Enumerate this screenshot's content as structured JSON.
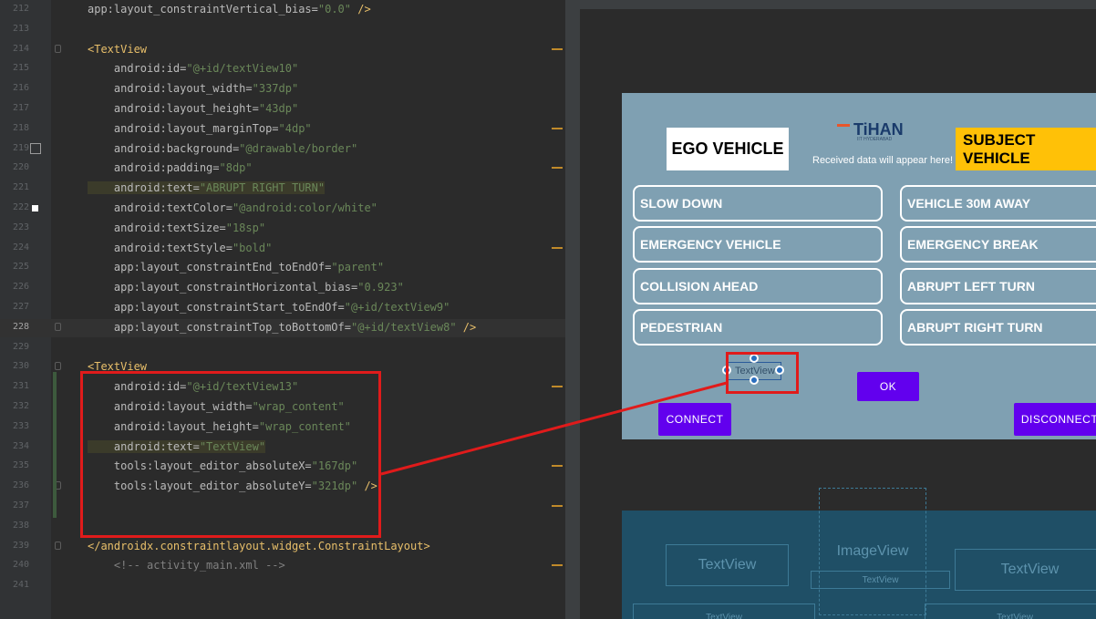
{
  "editor": {
    "lines": [
      {
        "no": "212",
        "tokens": [
          {
            "c": "t-attr",
            "t": "app:layout_constraintVertical_bias="
          },
          {
            "c": "t-val",
            "t": "\"0.0\""
          },
          {
            "c": "t-tag",
            "t": " />"
          }
        ]
      },
      {
        "no": "213",
        "tokens": []
      },
      {
        "no": "214",
        "tokens": [
          {
            "c": "t-tag",
            "t": "<TextView"
          }
        ]
      },
      {
        "no": "215",
        "tokens": [
          {
            "c": "t-attr",
            "t": "    android:id="
          },
          {
            "c": "t-val",
            "t": "\"@+id/textView10\""
          }
        ]
      },
      {
        "no": "216",
        "tokens": [
          {
            "c": "t-attr",
            "t": "    android:layout_width="
          },
          {
            "c": "t-val",
            "t": "\"337dp\""
          }
        ]
      },
      {
        "no": "217",
        "tokens": [
          {
            "c": "t-attr",
            "t": "    android:layout_height="
          },
          {
            "c": "t-val",
            "t": "\"43dp\""
          }
        ]
      },
      {
        "no": "218",
        "tokens": [
          {
            "c": "t-attr",
            "t": "    android:layout_marginTop="
          },
          {
            "c": "t-val",
            "t": "\"4dp\""
          }
        ]
      },
      {
        "no": "219",
        "tokens": [
          {
            "c": "t-attr",
            "t": "    android:background="
          },
          {
            "c": "t-val",
            "t": "\"@drawable/border\""
          }
        ]
      },
      {
        "no": "220",
        "tokens": [
          {
            "c": "t-attr",
            "t": "    android:padding="
          },
          {
            "c": "t-val",
            "t": "\"8dp\""
          }
        ]
      },
      {
        "no": "221",
        "tokens": [
          {
            "c": "t-attr hl",
            "t": "    android:text="
          },
          {
            "c": "t-val hl",
            "t": "\"ABRUPT RIGHT TURN\""
          }
        ]
      },
      {
        "no": "222",
        "tokens": [
          {
            "c": "t-attr",
            "t": "    android:textColor="
          },
          {
            "c": "t-val",
            "t": "\"@android:color/white\""
          }
        ]
      },
      {
        "no": "223",
        "tokens": [
          {
            "c": "t-attr",
            "t": "    android:textSize="
          },
          {
            "c": "t-val",
            "t": "\"18sp\""
          }
        ]
      },
      {
        "no": "224",
        "tokens": [
          {
            "c": "t-attr",
            "t": "    android:textStyle="
          },
          {
            "c": "t-val",
            "t": "\"bold\""
          }
        ]
      },
      {
        "no": "225",
        "tokens": [
          {
            "c": "t-attr",
            "t": "    app:layout_constraintEnd_toEndOf="
          },
          {
            "c": "t-val",
            "t": "\"parent\""
          }
        ]
      },
      {
        "no": "226",
        "tokens": [
          {
            "c": "t-attr",
            "t": "    app:layout_constraintHorizontal_bias="
          },
          {
            "c": "t-val",
            "t": "\"0.923\""
          }
        ]
      },
      {
        "no": "227",
        "tokens": [
          {
            "c": "t-attr",
            "t": "    app:layout_constraintStart_toEndOf="
          },
          {
            "c": "t-val",
            "t": "\"@+id/textView9\""
          }
        ]
      },
      {
        "no": "228",
        "tokens": [
          {
            "c": "t-attr",
            "t": "    app:layout_constraintTop_toBottomOf="
          },
          {
            "c": "t-val",
            "t": "\"@+id/textView8\""
          },
          {
            "c": "t-tag",
            "t": " />"
          }
        ]
      },
      {
        "no": "229",
        "tokens": []
      },
      {
        "no": "230",
        "tokens": [
          {
            "c": "t-tag",
            "t": "<TextView"
          }
        ]
      },
      {
        "no": "231",
        "tokens": [
          {
            "c": "t-attr",
            "t": "    android:id="
          },
          {
            "c": "t-val",
            "t": "\"@+id/textView13\""
          }
        ]
      },
      {
        "no": "232",
        "tokens": [
          {
            "c": "t-attr",
            "t": "    android:layout_width="
          },
          {
            "c": "t-val",
            "t": "\"wrap_content\""
          }
        ]
      },
      {
        "no": "233",
        "tokens": [
          {
            "c": "t-attr",
            "t": "    android:layout_height="
          },
          {
            "c": "t-val",
            "t": "\"wrap_content\""
          }
        ]
      },
      {
        "no": "234",
        "tokens": [
          {
            "c": "t-attr hl",
            "t": "    android:text="
          },
          {
            "c": "t-val hl",
            "t": "\"TextView\""
          }
        ]
      },
      {
        "no": "235",
        "tokens": [
          {
            "c": "t-attr",
            "t": "    tools:layout_editor_absoluteX="
          },
          {
            "c": "t-val",
            "t": "\"167dp\""
          }
        ]
      },
      {
        "no": "236",
        "tokens": [
          {
            "c": "t-attr",
            "t": "    tools:layout_editor_absoluteY="
          },
          {
            "c": "t-val",
            "t": "\"321dp\""
          },
          {
            "c": "t-tag",
            "t": " />"
          }
        ]
      },
      {
        "no": "237",
        "tokens": []
      },
      {
        "no": "238",
        "tokens": []
      },
      {
        "no": "239",
        "tokens": [
          {
            "c": "t-tag",
            "t": "</androidx.constraintlayout.widget.ConstraintLayout>"
          }
        ]
      },
      {
        "no": "240",
        "tokens": [
          {
            "c": "t-cmt",
            "t": "    <!-- activity_main.xml -->"
          }
        ]
      },
      {
        "no": "241",
        "tokens": []
      }
    ]
  },
  "design": {
    "ego_label": "EGO VEHICLE",
    "subject_label": "SUBJECT VEHICLE",
    "logo_text": "TiHAN",
    "logo_sub": "IIT HYDERABAD",
    "received_text": "Received data will appear here!",
    "left_messages": [
      "SLOW DOWN",
      "EMERGENCY VEHICLE",
      "COLLISION AHEAD",
      "PEDESTRIAN"
    ],
    "right_messages": [
      "VEHICLE 30M AWAY",
      "EMERGENCY BREAK",
      "ABRUPT LEFT TURN",
      "ABRUPT RIGHT TURN"
    ],
    "selected_textview": "TextView",
    "ok_label": "OK",
    "connect_label": "CONNECT",
    "disconnect_label": "DISCONNECT",
    "blueprint": {
      "textview_left": "TextView",
      "textview_right": "TextView",
      "imageview": "ImageView",
      "textview_mid": "TextView",
      "textview_bottom_left": "TextView",
      "textview_bottom_right": "TextView"
    }
  },
  "colors": {
    "annotation": "#e01b1b",
    "button": "#6200ee",
    "subject_bg": "#ffc107",
    "device_bg": "#7fa0b2",
    "blueprint_bg": "#1f4f66"
  }
}
